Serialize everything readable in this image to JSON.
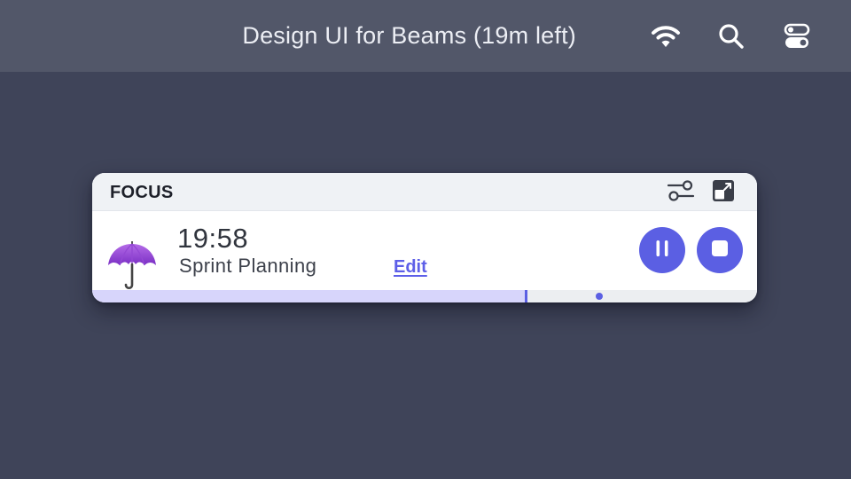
{
  "menubar": {
    "title": "Design UI for Beams (19m left)",
    "icons": [
      "wifi-icon",
      "search-icon",
      "control-center-icon"
    ],
    "color": "#525769"
  },
  "widget": {
    "title": "FOCUS",
    "header_icons": [
      "sliders-icon",
      "expand-window-icon"
    ],
    "session": {
      "icon": "umbrella-icon",
      "time_remaining": "19:58",
      "task": "Sprint Planning",
      "edit_label": "Edit"
    },
    "controls": [
      "pause-icon",
      "stop-icon"
    ],
    "progress": {
      "fill_fraction": 0.651,
      "marker_fraction": 0.65,
      "dot_fraction": 0.762
    }
  },
  "colors": {
    "background": "#3f4459",
    "accent": "#5b5fe3",
    "progress_fill": "#d7d5fb",
    "header": "#eff2f5"
  }
}
